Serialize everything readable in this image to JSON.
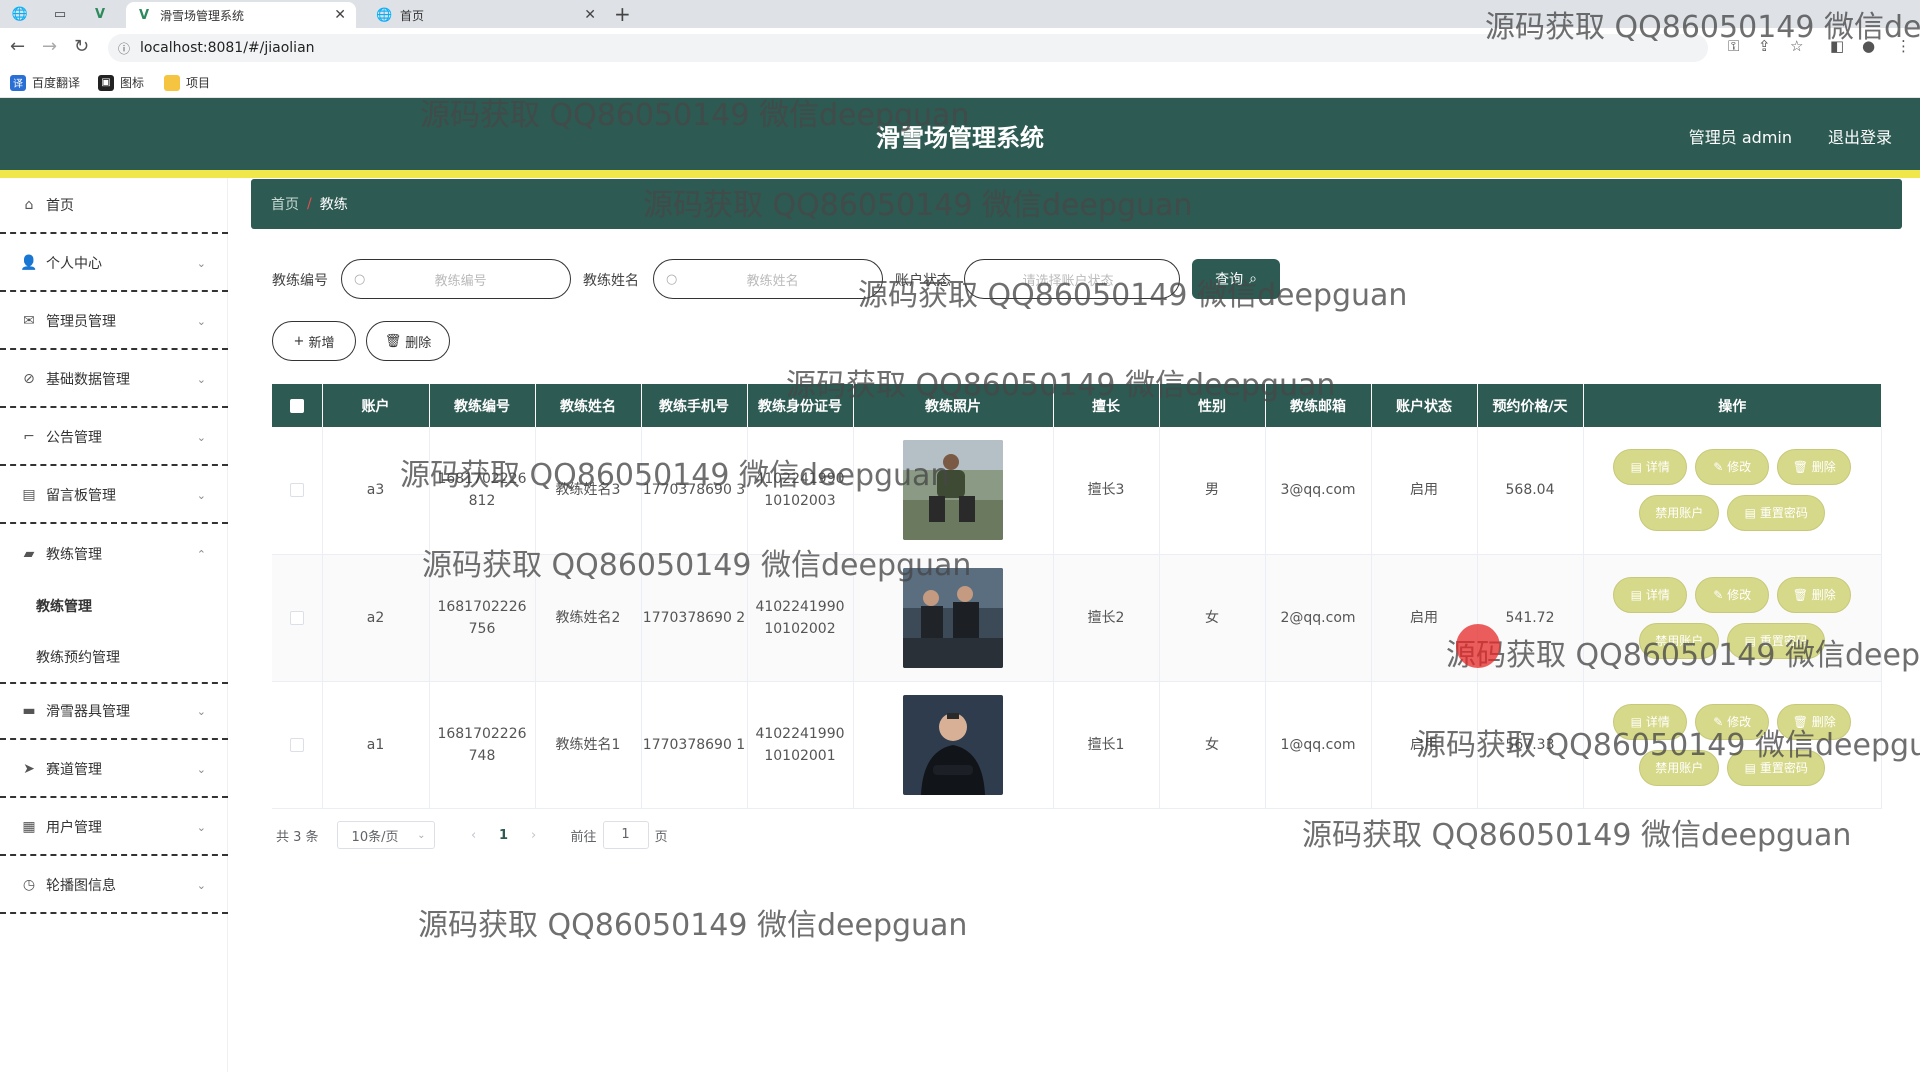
{
  "browser": {
    "tabs": [
      {
        "title": "滑雪场管理系统",
        "active": true
      },
      {
        "title": "首页",
        "active": false
      }
    ],
    "url": "localhost:8081/#/jiaolian",
    "bookmarks": [
      "百度翻译",
      "图标",
      "项目"
    ]
  },
  "header": {
    "title": "滑雪场管理系统",
    "user": "管理员 admin",
    "logout": "退出登录"
  },
  "sidebar": {
    "items": [
      {
        "label": "首页",
        "icon": "home-icon"
      },
      {
        "label": "个人中心",
        "icon": "user-icon"
      },
      {
        "label": "管理员管理",
        "icon": "mail-icon"
      },
      {
        "label": "基础数据管理",
        "icon": "compass-icon"
      },
      {
        "label": "公告管理",
        "icon": "crop-icon"
      },
      {
        "label": "留言板管理",
        "icon": "stack-icon"
      },
      {
        "label": "教练管理",
        "icon": "ticket-icon"
      },
      {
        "label": "滑雪器具管理",
        "icon": "equipment-icon"
      },
      {
        "label": "赛道管理",
        "icon": "send-icon"
      },
      {
        "label": "用户管理",
        "icon": "clipboard-icon"
      },
      {
        "label": "轮播图信息",
        "icon": "clock-icon"
      }
    ],
    "sub_items": [
      "教练管理",
      "教练预约管理"
    ]
  },
  "breadcrumb": {
    "home": "首页",
    "current": "教练"
  },
  "search": {
    "code_label": "教练编号",
    "code_placeholder": "教练编号",
    "name_label": "教练姓名",
    "name_placeholder": "教练姓名",
    "status_label": "账户状态",
    "status_placeholder": "请选择账户状态",
    "query_button": "查询"
  },
  "actions": {
    "add": "新增",
    "delete": "删除"
  },
  "table": {
    "columns": [
      "账户",
      "教练编号",
      "教练姓名",
      "教练手机号",
      "教练身份证号",
      "教练照片",
      "擅长",
      "性别",
      "教练邮箱",
      "账户状态",
      "预约价格/天",
      "操作"
    ],
    "rows": [
      {
        "account": "a3",
        "code": "1681702226 812",
        "name": "教练姓名3",
        "phone": "1770378690 3",
        "idcard": "4102241990 10102003",
        "photo": "coach-photo-1",
        "skill": "擅长3",
        "gender": "男",
        "email": "3@qq.com",
        "status": "启用",
        "price": "568.04"
      },
      {
        "account": "a2",
        "code": "1681702226 756",
        "name": "教练姓名2",
        "phone": "1770378690 2",
        "idcard": "4102241990 10102002",
        "photo": "coach-photo-2",
        "skill": "擅长2",
        "gender": "女",
        "email": "2@qq.com",
        "status": "启用",
        "price": "541.72"
      },
      {
        "account": "a1",
        "code": "1681702226 748",
        "name": "教练姓名1",
        "phone": "1770378690 1",
        "idcard": "4102241990 10102001",
        "photo": "coach-photo-3",
        "skill": "擅长1",
        "gender": "女",
        "email": "1@qq.com",
        "status": "启用",
        "price": "567.33"
      }
    ],
    "row_actions": {
      "detail": "详情",
      "edit": "修改",
      "delete": "删除",
      "disable": "禁用账户",
      "reset": "重置密码"
    }
  },
  "pagination": {
    "total": "共 3 条",
    "page_size": "10条/页",
    "current_page": "1",
    "goto_label": "前往",
    "goto_value": "1",
    "page_unit": "页"
  },
  "watermark": "源码获取 QQ86050149 微信deepguan",
  "colors": {
    "primary": "#2d5a52",
    "accent_stripe": "#f0e84a",
    "op_button": "#d7d98a"
  }
}
